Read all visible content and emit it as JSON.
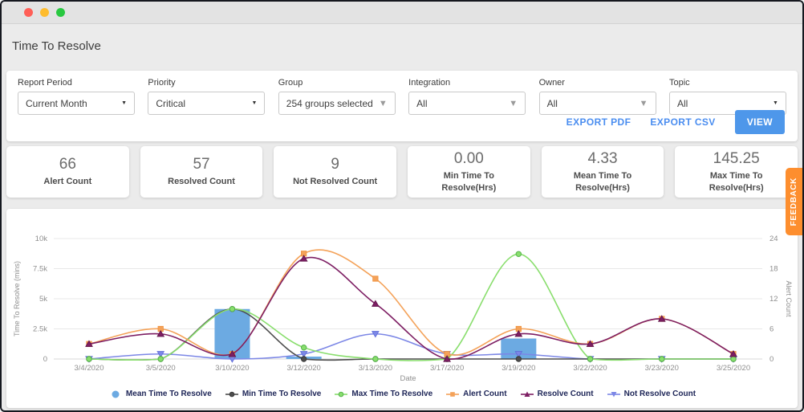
{
  "header": {
    "title": "Time To Resolve"
  },
  "window_controls": {
    "close": "close",
    "minimize": "minimize",
    "zoom": "zoom"
  },
  "colors": {
    "traffic_red": "#ff5f57",
    "traffic_yellow": "#febc2e",
    "traffic_green": "#28c840",
    "accent_blue": "#4a8df0",
    "view_button": "#4e97ea",
    "feedback_orange": "#fd8e2e"
  },
  "filters": [
    {
      "label": "Report Period",
      "value": "Current Month",
      "arrow_style": "native"
    },
    {
      "label": "Priority",
      "value": "Critical",
      "arrow_style": "native"
    },
    {
      "label": "Group",
      "value": "254 groups selected",
      "arrow_style": "muted"
    },
    {
      "label": "Integration",
      "value": "All",
      "arrow_style": "muted"
    },
    {
      "label": "Owner",
      "value": "All",
      "arrow_style": "muted"
    },
    {
      "label": "Topic",
      "value": "All",
      "arrow_style": "native"
    }
  ],
  "actions": {
    "export_pdf": "EXPORT PDF",
    "export_csv": "EXPORT CSV",
    "view": "VIEW"
  },
  "stats": [
    {
      "value": "66",
      "label": "Alert Count"
    },
    {
      "value": "57",
      "label": "Resolved Count"
    },
    {
      "value": "9",
      "label": "Not Resolved Count"
    },
    {
      "value": "0.00",
      "label": "Min Time To Resolve(Hrs)"
    },
    {
      "value": "4.33",
      "label": "Mean Time To Resolve(Hrs)"
    },
    {
      "value": "145.25",
      "label": "Max Time To Resolve(Hrs)"
    }
  ],
  "feedback_tab": "FEEDBACK",
  "chart_data": {
    "type": "mixed-bar-line",
    "x": [
      "3/4/2020",
      "3/5/2020",
      "3/10/2020",
      "3/12/2020",
      "3/13/2020",
      "3/17/2020",
      "3/19/2020",
      "3/22/2020",
      "3/23/2020",
      "3/25/2020"
    ],
    "xlabel": "Date",
    "grid": true,
    "legend_position": "bottom",
    "left_axis": {
      "title": "Time To Resolve (mins)",
      "max": 10000,
      "ticks": [
        {
          "v": 0,
          "label": "0"
        },
        {
          "v": 2500,
          "label": "2.5k"
        },
        {
          "v": 5000,
          "label": "5k"
        },
        {
          "v": 7500,
          "label": "7.5k"
        },
        {
          "v": 10000,
          "label": "10k"
        }
      ]
    },
    "right_axis": {
      "title": "Alert Count",
      "max": 24,
      "ticks": [
        {
          "v": 0,
          "label": "0"
        },
        {
          "v": 6,
          "label": "6"
        },
        {
          "v": 12,
          "label": "12"
        },
        {
          "v": 18,
          "label": "18"
        },
        {
          "v": 24,
          "label": "24"
        }
      ]
    },
    "series": [
      {
        "name": "Mean Time To Resolve",
        "type": "bar",
        "axis": "left",
        "color": "#6caae2",
        "values": [
          null,
          null,
          4150,
          200,
          null,
          null,
          1700,
          null,
          null,
          null
        ]
      },
      {
        "name": "Min Time To Resolve",
        "type": "line",
        "axis": "left",
        "color": "#4d4d4d",
        "marker": "circle",
        "marker_stroke": "#3a3a3a",
        "values": [
          0,
          0,
          4150,
          0,
          0,
          0,
          0,
          0,
          0,
          0
        ]
      },
      {
        "name": "Max Time To Resolve",
        "type": "line",
        "axis": "left",
        "color": "#89de6d",
        "marker": "circle",
        "marker_stroke": "#55b44b",
        "values": [
          0,
          0,
          4150,
          950,
          0,
          0,
          8715,
          0,
          0,
          0
        ]
      },
      {
        "name": "Alert Count",
        "type": "line",
        "axis": "right",
        "color": "#f4a259",
        "marker": "square",
        "marker_stroke": "#ef8f3a",
        "values": [
          3,
          6,
          1,
          21,
          16,
          1,
          6,
          3,
          8,
          1
        ]
      },
      {
        "name": "Resolve Count",
        "type": "line",
        "axis": "right",
        "color": "#7d1e63",
        "marker": "triangle-up",
        "marker_stroke": "#5e1149",
        "values": [
          3,
          5,
          1,
          20,
          11,
          0,
          5,
          3,
          8,
          1
        ]
      },
      {
        "name": "Not Resolve Count",
        "type": "line",
        "axis": "right",
        "color": "#7c87e6",
        "marker": "triangle-down",
        "marker_stroke": "#5f6cd8",
        "values": [
          0,
          1,
          0,
          1,
          5,
          1,
          1,
          0,
          0,
          0
        ]
      }
    ]
  }
}
